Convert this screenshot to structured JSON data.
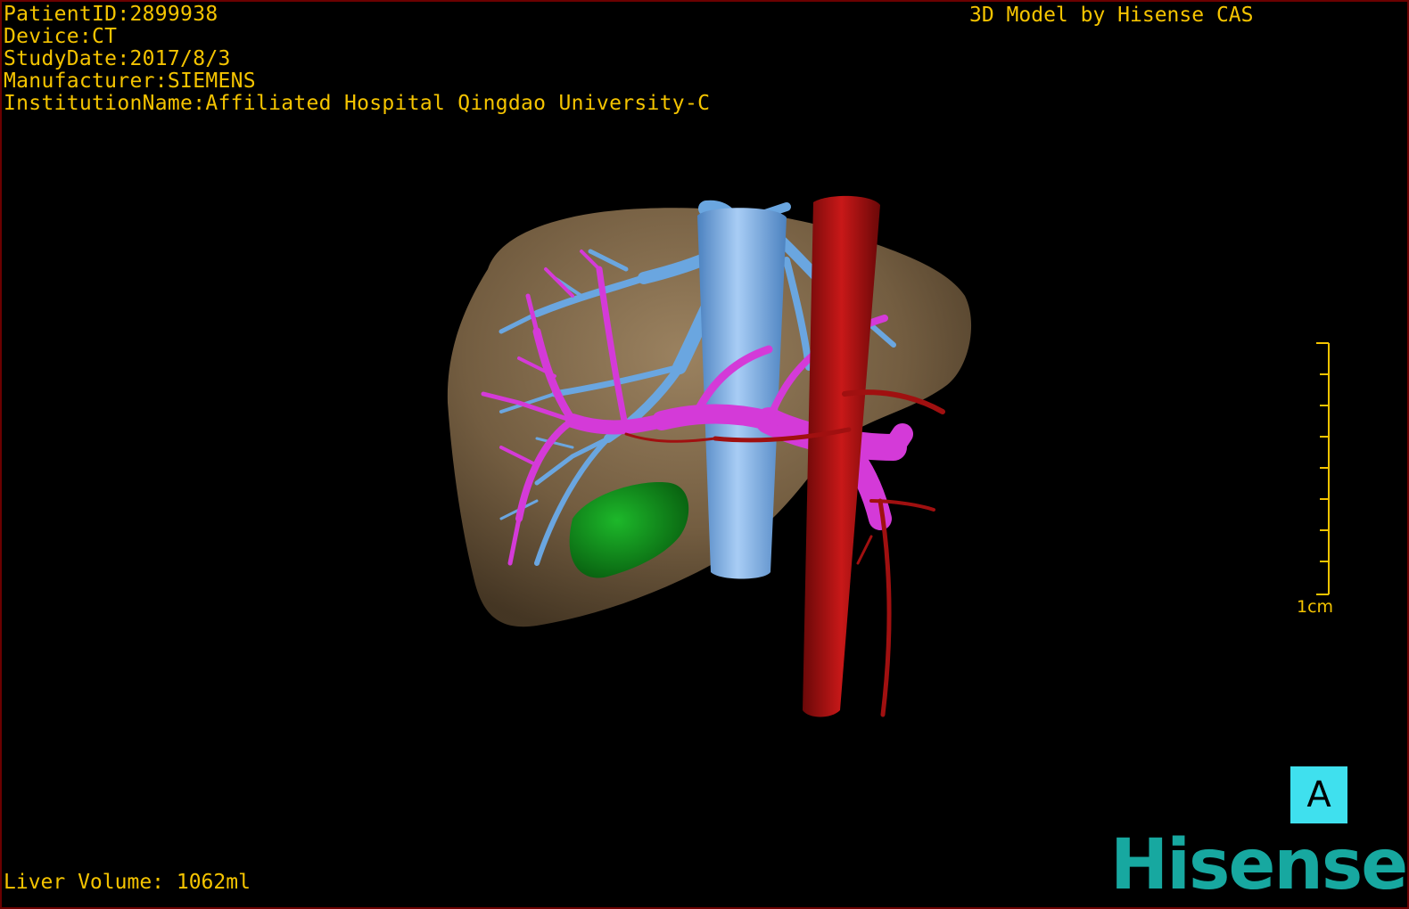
{
  "overlay": {
    "patient_id": "PatientID:2899938",
    "device": "Device:CT",
    "study_date": "StudyDate:2017/8/3",
    "manufacturer": "Manufacturer:SIEMENS",
    "institution": "InstitutionName:Affiliated Hospital Qingdao University-C",
    "model_credit": "3D Model by Hisense CAS",
    "liver_volume": "Liver Volume: 1062ml"
  },
  "scale": {
    "label": "1cm"
  },
  "view_button": {
    "label": "A"
  },
  "brand": {
    "logo_text": "Hisense"
  },
  "structures": {
    "liver": "liver-surface",
    "hepatic_veins": "hepatic-vein-tree",
    "portal_vein": "portal-vein-tree",
    "aorta": "aorta",
    "gallbladder": "gallbladder",
    "ivc": "inferior-vena-cava"
  },
  "colors": {
    "overlay_text": "#f5c400",
    "liver": "#8a7150",
    "hepatic_vein": "#6aa6e0",
    "portal_vein": "#d43ad8",
    "artery": "#a01010",
    "gallbladder": "#0f8a1a",
    "view_button_bg": "#3fe0ee",
    "brand": "#17a8a0",
    "frame": "#6b0000"
  }
}
